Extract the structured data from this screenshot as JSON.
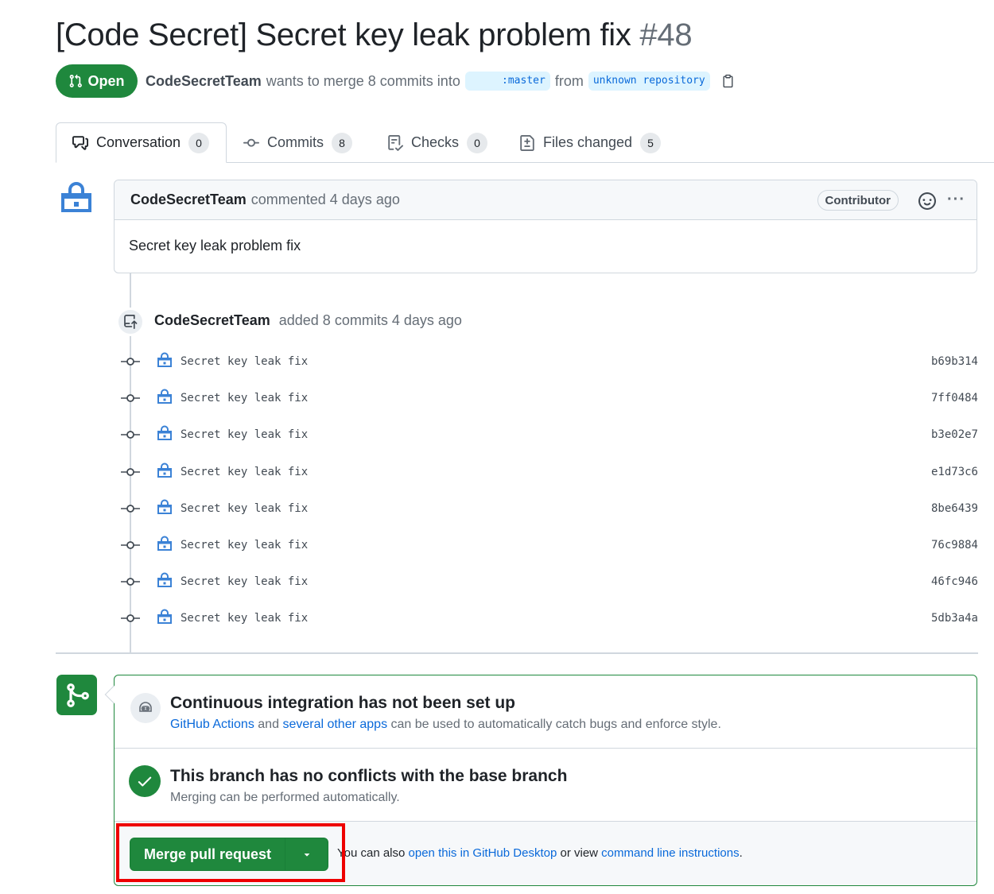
{
  "pr": {
    "title": "[Code Secret] Secret key leak problem fix",
    "number": "#48",
    "state": "Open",
    "author": "CodeSecretTeam",
    "merge_text": "wants to merge 8 commits into",
    "base_branch": ":master",
    "from_text": "from",
    "head_branch": "unknown repository"
  },
  "tabs": [
    {
      "label": "Conversation",
      "count": "0",
      "icon": "comment-discussion-icon"
    },
    {
      "label": "Commits",
      "count": "8",
      "icon": "git-commit-icon"
    },
    {
      "label": "Checks",
      "count": "0",
      "icon": "checklist-icon"
    },
    {
      "label": "Files changed",
      "count": "5",
      "icon": "file-diff-icon"
    }
  ],
  "comment": {
    "author": "CodeSecretTeam",
    "meta": "commented 4 days ago",
    "role": "Contributor",
    "body": "Secret key leak problem fix"
  },
  "push_event": {
    "author": "CodeSecretTeam",
    "text": "added 8 commits 4 days ago"
  },
  "commits": [
    {
      "message": "Secret key leak fix",
      "sha": "b69b314"
    },
    {
      "message": "Secret key leak fix",
      "sha": "7ff0484"
    },
    {
      "message": "Secret key leak fix",
      "sha": "b3e02e7"
    },
    {
      "message": "Secret key leak fix",
      "sha": "e1d73c6"
    },
    {
      "message": "Secret key leak fix",
      "sha": "8be6439"
    },
    {
      "message": "Secret key leak fix",
      "sha": "76c9884"
    },
    {
      "message": "Secret key leak fix",
      "sha": "46fc946"
    },
    {
      "message": "Secret key leak fix",
      "sha": "5db3a4a"
    }
  ],
  "merge_box": {
    "ci": {
      "title": "Continuous integration has not been set up",
      "link1": "GitHub Actions",
      "and": "and",
      "link2": "several other apps",
      "rest": "can be used to automatically catch bugs and enforce style."
    },
    "conflicts": {
      "title": "This branch has no conflicts with the base branch",
      "subtitle": "Merging can be performed automatically."
    },
    "button_label": "Merge pull request",
    "hint": {
      "pre": "You can also",
      "link1": "open this in GitHub Desktop",
      "mid": "or view",
      "link2": "command line instructions",
      "post": "."
    }
  },
  "colors": {
    "accent_green": "#1f883d",
    "link_blue": "#0969da",
    "highlight_red": "#e00000"
  }
}
